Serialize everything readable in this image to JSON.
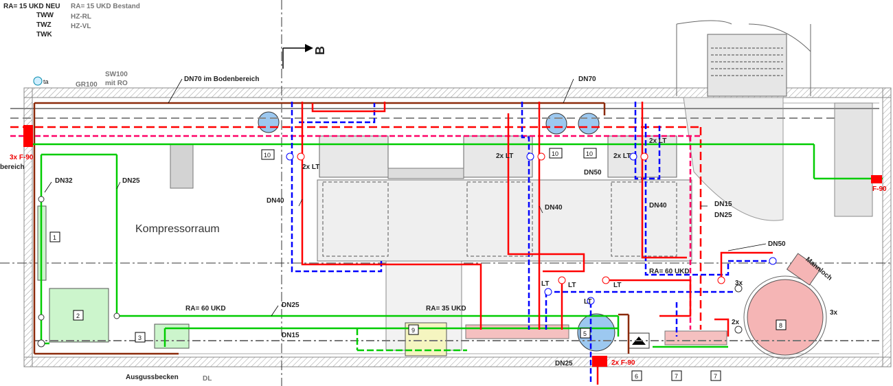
{
  "legend": {
    "new_title": "RA= 15 UKD NEU",
    "new_items": [
      "TWW",
      "TWZ",
      "TWK"
    ],
    "existing_title": "RA= 15 UKD Bestand",
    "existing_items": [
      "HZ-RL",
      "HZ-VL"
    ]
  },
  "section_marker": "B",
  "room_name": "Kompressorraum",
  "labels": {
    "gr100": "GR100",
    "sw100": "SW100",
    "mit_ro": "mit RO",
    "ta": "ta",
    "dn70_floor": "DN70 im Bodenbereich",
    "dn70": "DN70",
    "dn32": "DN32",
    "dn25_left": "DN25",
    "dn40_a": "DN40",
    "dn40_b": "DN40",
    "dn40_c": "DN40",
    "dn50_mid": "DN50",
    "dn15_right": "DN15",
    "dn25_right": "DN25",
    "dn50_right": "DN50",
    "ra60_left": "RA= 60 UKD",
    "dn25_bottom": "DN25",
    "dn15_bottom": "DN15",
    "ra35": "RA= 35 UKD",
    "ra60_right": "RA= 60 UKD",
    "lt2x_a": "2x LT",
    "lt2x_b": "2x LT",
    "lt2x_c": "2x LT",
    "lt2x_d": "2x LT",
    "lt_a": "LT",
    "lt_b": "LT",
    "lt_c": "LT",
    "lt_d": "LT",
    "x3_a": "3x",
    "x3_b": "3x",
    "x2": "2x",
    "mannloch": "Mannloch",
    "dn25_tank": "DN25",
    "f90_left": "3x F-90",
    "f90_right": "F-90",
    "f90_bottom": "2x F-90",
    "bereich": "bereich",
    "ausgussbecken": "Ausgussbecken",
    "dl": "DL"
  },
  "tags": {
    "t1": "1",
    "t2": "2",
    "t3": "3",
    "t5": "5",
    "t6": "6",
    "t7a": "7",
    "t7b": "7",
    "t8": "8",
    "t9": "9",
    "t10a": "10",
    "t10b": "10",
    "t10c": "10"
  },
  "colors": {
    "twk": "#00cc00",
    "tww": "#ff0000",
    "twz": "#ff0066",
    "hz_vl": "#ff0000",
    "hz_rl": "#0000ff",
    "drain": "#8b2a0a",
    "gas": "#888888",
    "equipment_green": "#ccf5cc",
    "tank_pink": "#f5b5b5",
    "vessel_blue": "#9cc8f0"
  }
}
